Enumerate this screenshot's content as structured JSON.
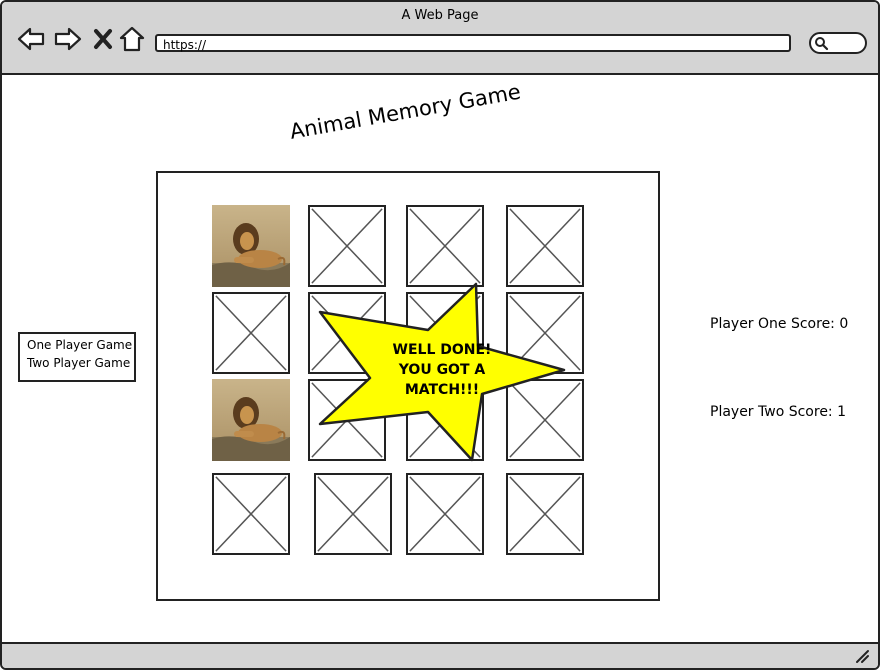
{
  "window": {
    "title": "A Web Page"
  },
  "browser": {
    "url": "https://"
  },
  "game": {
    "title": "Animal Memory Game"
  },
  "menu": {
    "items": [
      "One Player Game",
      "Two Player Game"
    ]
  },
  "scores": {
    "player_one": "Player One Score: 0",
    "player_two": "Player Two Score: 1"
  },
  "popup": {
    "line1": "WELL DONE!",
    "line2": "YOU GOT A",
    "line3": "MATCH!!!"
  },
  "cards": [
    "lion",
    "hidden",
    "hidden",
    "hidden",
    "hidden",
    "hidden",
    "hidden",
    "hidden",
    "lion",
    "hidden",
    "hidden",
    "hidden",
    "hidden",
    "hidden",
    "hidden",
    "hidden"
  ],
  "colors": {
    "chrome": "#d4d4d4",
    "star": "#ffff00",
    "outline": "#222222"
  }
}
